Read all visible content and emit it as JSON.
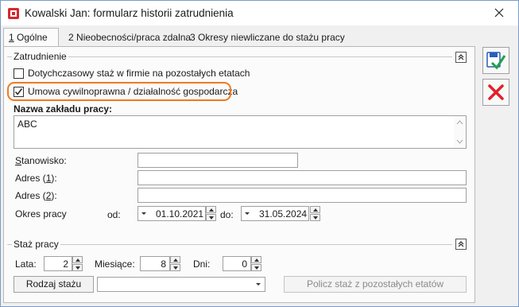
{
  "window": {
    "title": "Kowalski Jan: formularz historii zatrudnienia"
  },
  "tabs": [
    {
      "key": "1",
      "label": " Ogólne"
    },
    {
      "key": "2",
      "label": " Nieobecności/praca zdalna"
    },
    {
      "key": "3",
      "label": " Okresy niewliczane do stażu pracy"
    }
  ],
  "employment": {
    "group_label": "Zatrudnienie",
    "checkbox_additional": {
      "label": "Dotychczasowy staż w firmie na pozostałych etatach",
      "checked": false
    },
    "checkbox_civil": {
      "label": "Umowa cywilnoprawna / działalność gospodarcza",
      "checked": true
    },
    "workplace_label": "Nazwa zakładu pracy:",
    "workplace_value": "ABC",
    "position_label": "Stanowisko:",
    "position_value": "",
    "address1_label_pre": "Adres (",
    "address1_key": "1",
    "address1_label_post": "):",
    "address1_value": "",
    "address2_label_pre": "Adres (",
    "address2_key": "2",
    "address2_label_post": "):",
    "address2_value": "",
    "period_label": "Okres pracy",
    "from_label": "od:",
    "from_value": "01.10.2021",
    "to_label": "do:",
    "to_value": "31.05.2024"
  },
  "seniority": {
    "group_label": "Staż pracy",
    "years_label": "Lata:",
    "years_value": "2",
    "months_label": "Miesiące:",
    "months_value": "8",
    "days_label": "Dni:",
    "days_value": "0",
    "type_button": "Rodzaj stażu",
    "type_value": "",
    "calc_button": "Policz staż z pozostałych etatów"
  },
  "side_buttons": {
    "save_icon": "save-check-icon",
    "cancel_icon": "cancel-x-icon"
  },
  "colors": {
    "highlight": "#ee7a22",
    "cancel": "#e0202a",
    "save": "#2a5fb8"
  }
}
